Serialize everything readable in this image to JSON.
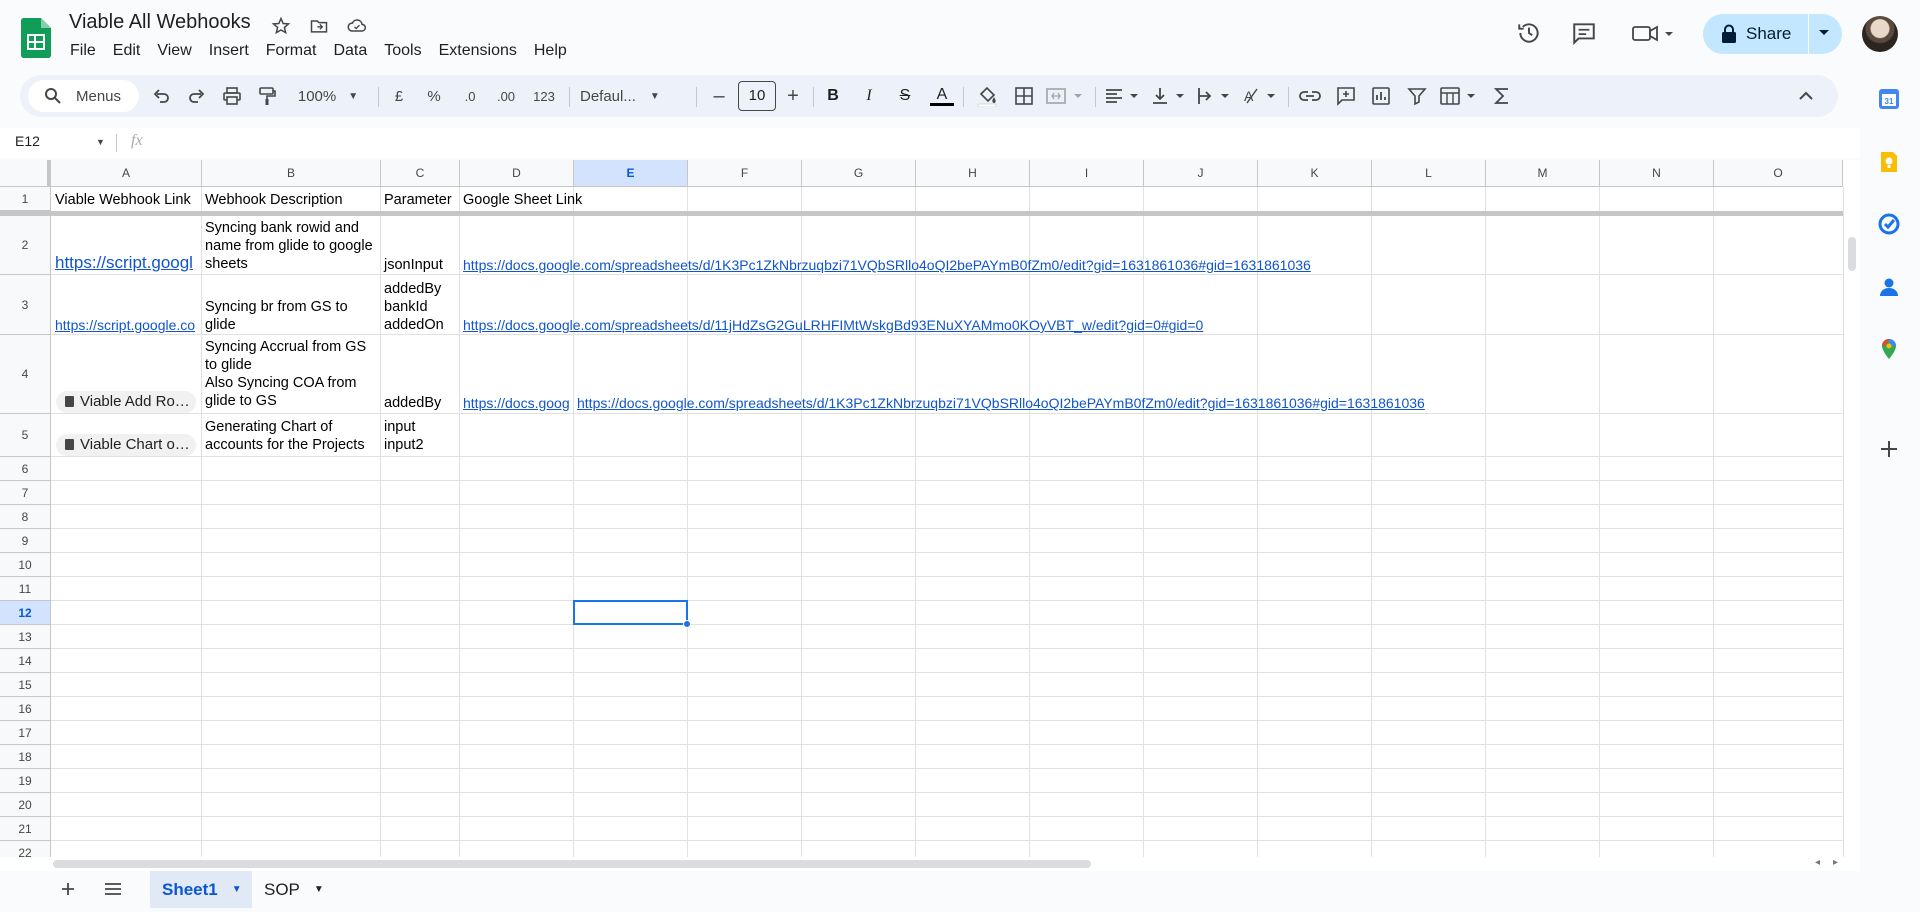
{
  "app": {
    "title": "Viable All Webhooks",
    "menu": [
      "File",
      "Edit",
      "View",
      "Insert",
      "Format",
      "Data",
      "Tools",
      "Extensions",
      "Help"
    ],
    "share_label": "Share"
  },
  "toolbar": {
    "search_label": "Menus",
    "zoom": "100%",
    "currency": "£",
    "percent": "%",
    "dec_decrease": ".0",
    "dec_increase": ".00",
    "format_123": "123",
    "font": "Defaul...",
    "font_size": "10",
    "bold": "B",
    "italic": "I",
    "strike": "S",
    "text_color": "A"
  },
  "formula_bar": {
    "name_box": "E12",
    "fx": "fx",
    "content": ""
  },
  "columns": [
    "A",
    "B",
    "C",
    "D",
    "E",
    "F",
    "G",
    "H",
    "I",
    "J",
    "K",
    "L",
    "M",
    "N",
    "O"
  ],
  "selected_column": "E",
  "rows": [
    "1",
    "2",
    "3",
    "4",
    "5",
    "6",
    "7",
    "8",
    "9",
    "10",
    "11",
    "12",
    "13",
    "14",
    "15",
    "16",
    "17",
    "18",
    "19",
    "20",
    "21",
    "22"
  ],
  "selected_row": "12",
  "cells": {
    "A1": "Viable Webhook Link",
    "B1": "Webhook Description",
    "C1": "Parameter",
    "D1": "Google Sheet Link",
    "A2": "https://script.googl",
    "B2": "Syncing bank rowid and name from glide to google sheets",
    "C2": "jsonInput",
    "D2": "https://docs.google.com/spreadsheets/d/1K3Pc1ZkNbrzuqbzi71VQbSRllo4oQI2bePAYmB0fZm0/edit?gid=1631861036#gid=1631861036",
    "A3": "https://script.google.co",
    "B3": "Syncing br from GS to glide",
    "C3_1": "addedBy",
    "C3_2": "bankId",
    "C3_3": "addedOn",
    "D3": "https://docs.google.com/spreadsheets/d/11jHdZsG2GuLRHFIMtWskgBd93ENuXYAMmo0KOyVBT_w/edit?gid=0#gid=0",
    "A4": "Viable Add Ro…",
    "B4_1": "Syncing Accrual from GS to glide",
    "B4_2": "Also Syncing COA from glide to GS",
    "C4": "addedBy",
    "D4": "https://docs.goog",
    "E4": "https://docs.google.com/spreadsheets/d/1K3Pc1ZkNbrzuqbzi71VQbSRllo4oQI2bePAYmB0fZm0/edit?gid=1631861036#gid=1631861036",
    "A5": "Viable Chart o…",
    "B5": "Generating Chart of accounts for the Projects",
    "C5_1": "input",
    "C5_2": "input2"
  },
  "sheets": [
    "Sheet1",
    "SOP"
  ],
  "active_sheet": "Sheet1",
  "colors": {
    "accent": "#0b57d0",
    "share_bg": "#c2e7ff",
    "link": "#1155cc",
    "selection": "#1a73e8"
  }
}
